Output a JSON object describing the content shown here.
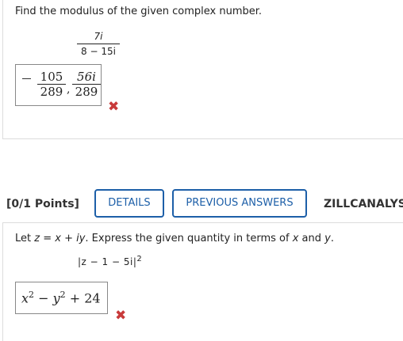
{
  "question1": {
    "prompt": "Find the modulus of the given complex number.",
    "fraction_numerator": "7i",
    "fraction_denominator": "8 − 15i",
    "answer": {
      "sign": "−",
      "num1": "105",
      "den1": "289",
      "separator": ",",
      "num2": "56i",
      "den2": "289"
    },
    "status_icon": "incorrect-x-icon"
  },
  "question2_header": {
    "points": "[0/1 Points]",
    "details_label": "DETAILS",
    "previous_answers_label": "PREVIOUS ANSWERS",
    "course_code": "ZILLCANALYS"
  },
  "question2": {
    "prompt_prefix": "Let ",
    "prompt_z": "z",
    "prompt_eq": " = ",
    "prompt_expr": "x + iy",
    "prompt_mid": ". Express the given quantity in terms of ",
    "prompt_x": "x",
    "prompt_and": " and ",
    "prompt_y": "y",
    "prompt_end": ".",
    "expression": "|z − 1 − 5i|",
    "expression_power": "2",
    "answer": {
      "x": "x",
      "exp_x": "2",
      "minus": " − ",
      "y": "y",
      "exp_y": "2",
      "rest": " + 24"
    },
    "status_icon": "incorrect-x-icon"
  },
  "colors": {
    "accent": "#1d5fa8",
    "error": "#c83a3a"
  }
}
